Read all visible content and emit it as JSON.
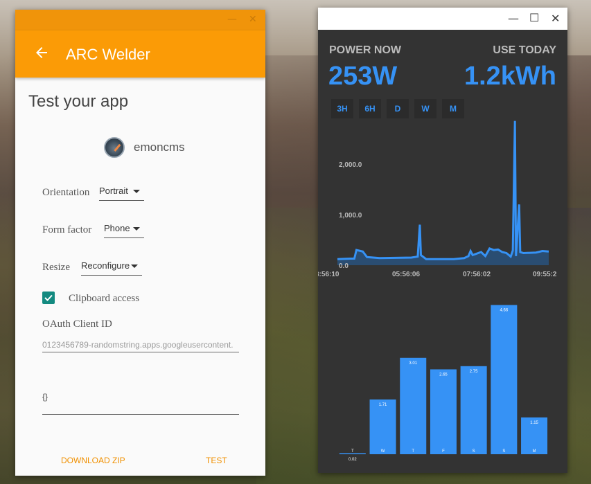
{
  "arc_welder": {
    "title": "ARC Welder",
    "subtitle": "Test your app",
    "app_name": "emoncms",
    "orientation": {
      "label": "Orientation",
      "value": "Portrait"
    },
    "form_factor": {
      "label": "Form factor",
      "value": "Phone"
    },
    "resize": {
      "label": "Resize",
      "value": "Reconfigure"
    },
    "clipboard": {
      "label": "Clipboard access",
      "checked": true
    },
    "oauth": {
      "label": "OAuth Client ID",
      "placeholder": "0123456789-randomstring.apps.googleusercontent."
    },
    "metadata_value": "{}",
    "download_label": "DOWNLOAD ZIP",
    "test_label": "TEST",
    "accent": "#fb9b06"
  },
  "power_app": {
    "power_now_label": "POWER NOW",
    "power_now_value": "253W",
    "use_today_label": "USE TODAY",
    "use_today_value": "1.2kWh",
    "ranges": [
      "3H",
      "6H",
      "D",
      "W",
      "M"
    ],
    "accent": "#3692f5"
  },
  "chart_data": [
    {
      "type": "area",
      "title": "",
      "ylim": [
        0,
        2900
      ],
      "y_ticks": [
        "0.0",
        "1,000.0",
        "2,000.0"
      ],
      "x_ticks": [
        "3:56:10",
        "05:56:06",
        "07:56:02",
        "09:55:2"
      ],
      "series": [
        {
          "values": [
            [
              0,
              120
            ],
            [
              6,
              130
            ],
            [
              8,
              130
            ],
            [
              9,
              300
            ],
            [
              12,
              270
            ],
            [
              14,
              160
            ],
            [
              20,
              140
            ],
            [
              35,
              150
            ],
            [
              38,
              170
            ],
            [
              39,
              800
            ],
            [
              39.5,
              200
            ],
            [
              42,
              120
            ],
            [
              55,
              120
            ],
            [
              60,
              140
            ],
            [
              62,
              180
            ],
            [
              63,
              280
            ],
            [
              64,
              200
            ],
            [
              68,
              260
            ],
            [
              70,
              180
            ],
            [
              72,
              330
            ],
            [
              74,
              300
            ],
            [
              76,
              310
            ],
            [
              78,
              260
            ],
            [
              80,
              240
            ],
            [
              82,
              170
            ],
            [
              83,
              290
            ],
            [
              84,
              2850
            ],
            [
              84.5,
              180
            ],
            [
              86,
              1200
            ],
            [
              86.5,
              260
            ],
            [
              88,
              240
            ],
            [
              94,
              250
            ],
            [
              97,
              280
            ],
            [
              100,
              270
            ]
          ]
        }
      ]
    },
    {
      "type": "bar",
      "title": "",
      "categories": [
        "T",
        "W",
        "T",
        "F",
        "S",
        "S",
        "M"
      ],
      "values": [
        0.02,
        1.71,
        3.01,
        2.65,
        2.75,
        4.66,
        1.15
      ],
      "data_labels": [
        "0.02",
        "1.71",
        "3.01",
        "2.65",
        "2.75",
        "4.66",
        "1.15"
      ],
      "ylim": [
        0,
        4.8
      ]
    }
  ]
}
